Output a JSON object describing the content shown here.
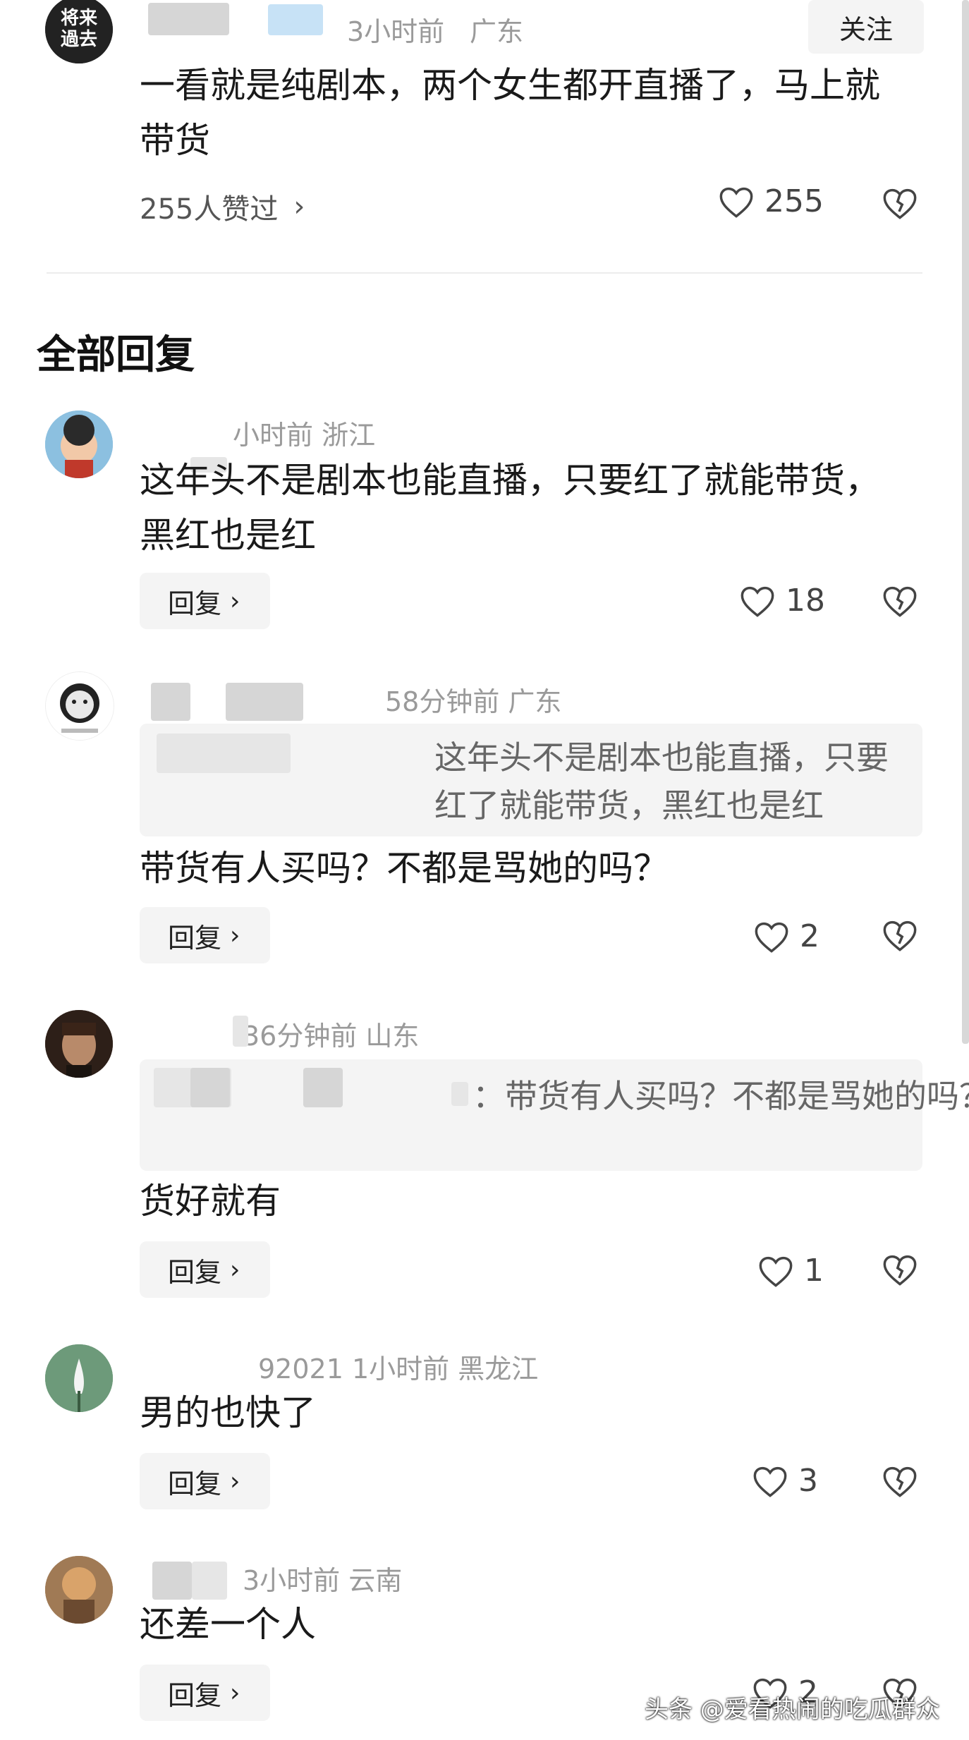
{
  "top_comment": {
    "time": "3小时前",
    "region": "广东",
    "follow_label": "关注",
    "content": "一看就是纯剧本，两个女生都开直播了，马上就带货",
    "liked_by": "255人赞过",
    "like_count": "255"
  },
  "section_title": "全部回复",
  "reply_label": "回复",
  "replies": [
    {
      "meta": "小时前   浙江",
      "content": "这年头不是剧本也能直播，只要红了就能带货，黑红也是红",
      "likes": "18"
    },
    {
      "meta": "58分钟前   广东",
      "quote": "这年头不是剧本也能直播，只要红了就能带货，黑红也是红",
      "content": "带货有人买吗？不都是骂她的吗？",
      "likes": "2"
    },
    {
      "meta": "36分钟前   山东",
      "quote": "：带货有人买吗？不都是骂她的吗？",
      "content": "货好就有",
      "likes": "1"
    },
    {
      "meta": "92021   1小时前   黑龙江",
      "content": "男的也快了",
      "likes": "3"
    },
    {
      "meta": "3小时前   云南",
      "content": "还差一个人",
      "likes": "2"
    }
  ],
  "watermark": "头条 @爱看热闹的吃瓜群众"
}
